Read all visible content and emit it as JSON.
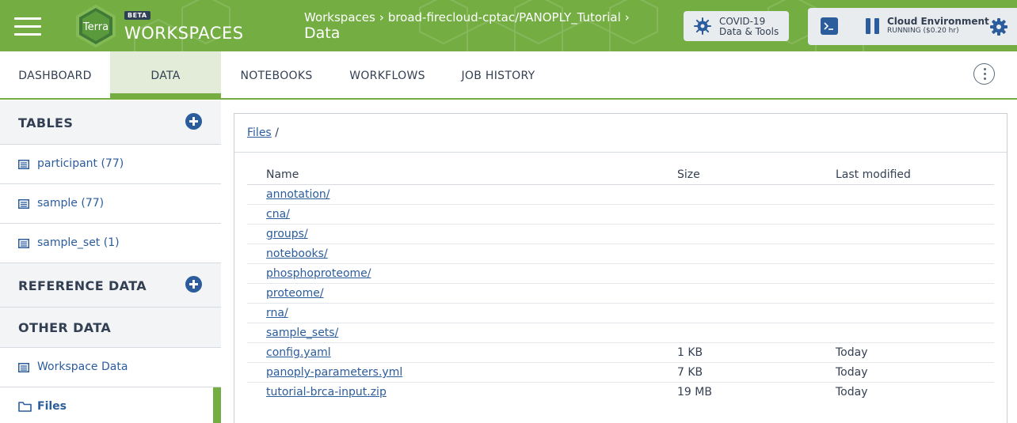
{
  "header": {
    "logo_text": "Terra",
    "beta_badge": "BETA",
    "app_title": "WORKSPACES",
    "breadcrumb": [
      "Workspaces",
      "broad-firecloud-cptac/PANOPLY_Tutorial"
    ],
    "breadcrumb_separator": "›",
    "page_title": "Data",
    "covid_button": {
      "line1": "COVID-19",
      "line2": "Data & Tools"
    },
    "cloud_environment": {
      "title": "Cloud Environment",
      "status": "RUNNING ($0.20 hr)"
    },
    "colors": {
      "brand_green": "#74ae43",
      "link_blue": "#2b5c9c"
    }
  },
  "tabs": [
    {
      "label": "DASHBOARD",
      "active": false
    },
    {
      "label": "DATA",
      "active": true
    },
    {
      "label": "NOTEBOOKS",
      "active": false
    },
    {
      "label": "WORKFLOWS",
      "active": false
    },
    {
      "label": "JOB HISTORY",
      "active": false
    }
  ],
  "sidebar": {
    "tables_title": "TABLES",
    "tables": [
      {
        "label": "participant (77)",
        "icon": "table-icon"
      },
      {
        "label": "sample (77)",
        "icon": "table-icon"
      },
      {
        "label": "sample_set (1)",
        "icon": "table-icon"
      }
    ],
    "reference_title": "REFERENCE DATA",
    "other_title": "OTHER DATA",
    "other_items": [
      {
        "label": "Workspace Data",
        "icon": "table-icon",
        "selected": false
      },
      {
        "label": "Files",
        "icon": "folder-icon",
        "selected": true
      }
    ]
  },
  "files": {
    "breadcrumb_link": "Files",
    "breadcrumb_suffix": "/",
    "columns": {
      "name": "Name",
      "size": "Size",
      "modified": "Last modified"
    },
    "rows": [
      {
        "name": "annotation/",
        "size": "",
        "modified": ""
      },
      {
        "name": "cna/",
        "size": "",
        "modified": ""
      },
      {
        "name": "groups/",
        "size": "",
        "modified": ""
      },
      {
        "name": "notebooks/",
        "size": "",
        "modified": ""
      },
      {
        "name": "phosphoproteome/",
        "size": "",
        "modified": ""
      },
      {
        "name": "proteome/",
        "size": "",
        "modified": ""
      },
      {
        "name": "rna/",
        "size": "",
        "modified": ""
      },
      {
        "name": "sample_sets/",
        "size": "",
        "modified": ""
      },
      {
        "name": "config.yaml",
        "size": "1 KB",
        "modified": "Today"
      },
      {
        "name": "panoply-parameters.yml",
        "size": "7 KB",
        "modified": "Today"
      },
      {
        "name": "tutorial-brca-input.zip",
        "size": "19 MB",
        "modified": "Today"
      }
    ]
  }
}
